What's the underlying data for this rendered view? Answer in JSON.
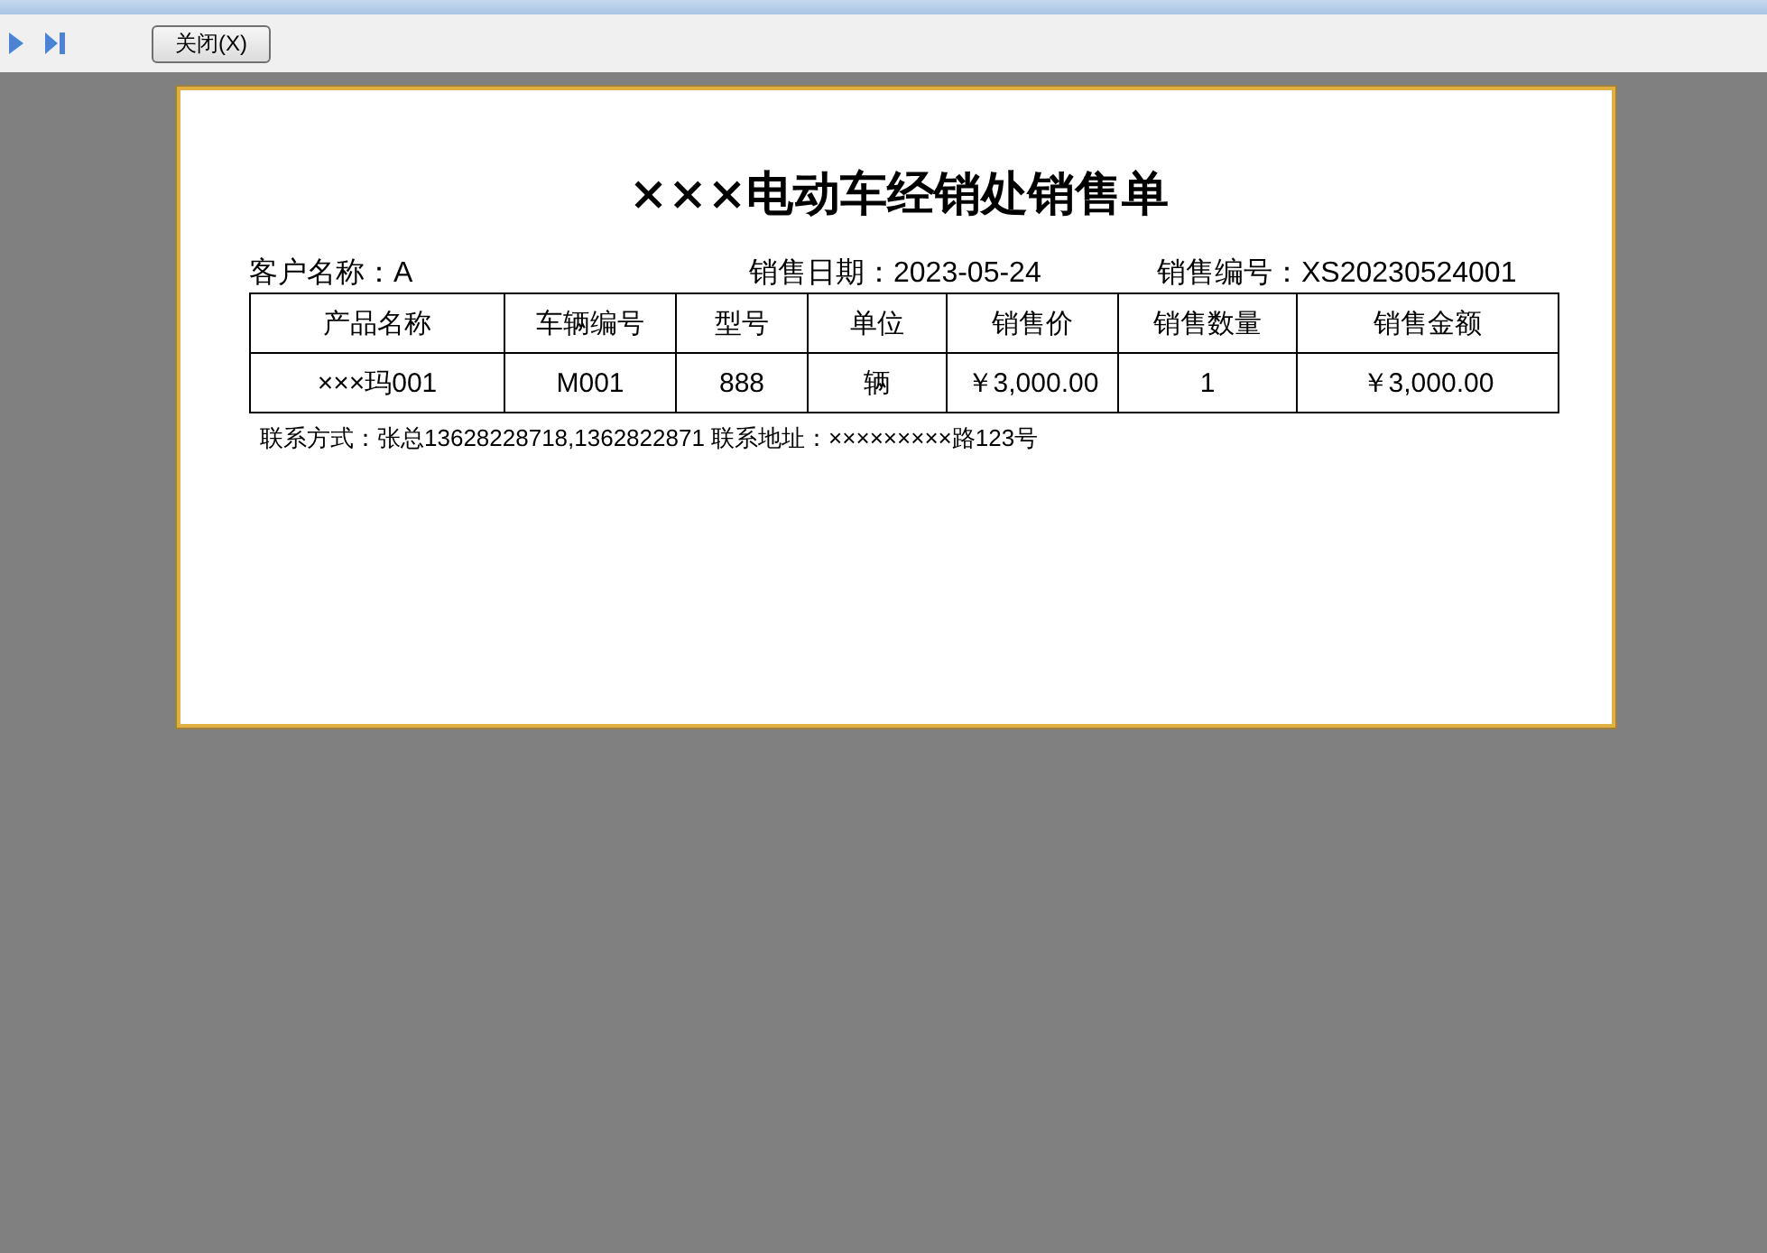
{
  "toolbar": {
    "buttons": [
      {
        "kind": "play"
      },
      {
        "kind": "last"
      }
    ],
    "close_button": "关闭(X)"
  },
  "report": {
    "title": "×××电动车经销处销售单",
    "info": [
      "客户名称：A",
      "销售日期：2023-05-24",
      "销售编号：XS20230524001"
    ],
    "table": {
      "columns": [
        "产品名称",
        "车辆编号",
        "型号",
        "单位",
        "销售价",
        "销售数量",
        "销售金额"
      ],
      "rows": [
        [
          "×××玛001",
          "M001",
          "888",
          "辆",
          "￥3,000.00",
          "1",
          "￥3,000.00"
        ]
      ]
    },
    "footer": "联系方式：张总13628228718,1362822871  联系地址：×××××××××路123号"
  }
}
